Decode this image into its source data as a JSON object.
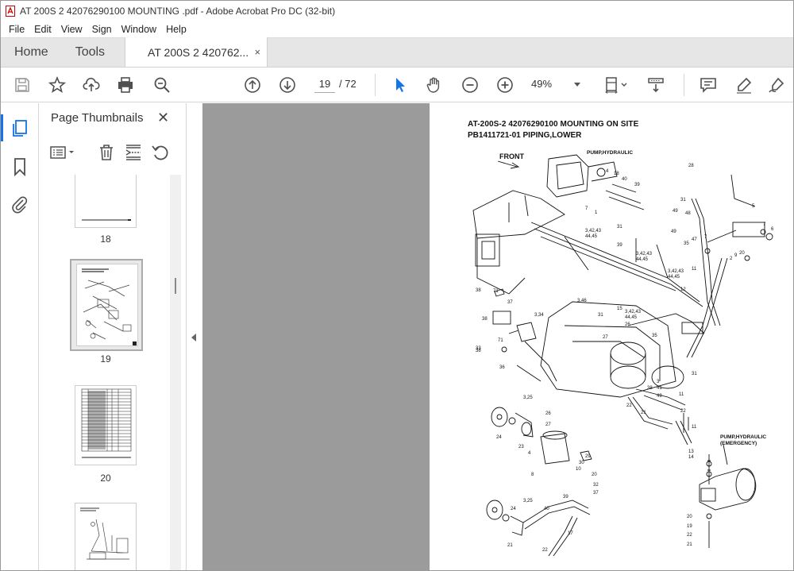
{
  "window": {
    "title": "AT 200S 2 42076290100 MOUNTING .pdf - Adobe Acrobat Pro DC (32-bit)"
  },
  "menu": [
    "File",
    "Edit",
    "View",
    "Sign",
    "Window",
    "Help"
  ],
  "tabs": {
    "home": "Home",
    "tools": "Tools",
    "document": "AT 200S 2 420762...",
    "close": "×"
  },
  "toolbar": {
    "current_page": "19",
    "page_total": "/ 72",
    "zoom": "49%"
  },
  "icons": [
    "save-icon",
    "star-icon",
    "upload-icon",
    "print-icon",
    "zoom-search-icon",
    "page-up-icon",
    "page-down-icon",
    "select-cursor-icon",
    "hand-icon",
    "zoom-out-icon",
    "zoom-in-icon",
    "fit-page-icon",
    "scroll-mode-icon",
    "comment-icon",
    "highlight-pen-icon",
    "sign-pen-icon"
  ],
  "panel": {
    "title": "Page Thumbnails",
    "close": "✕",
    "thumbnails": [
      {
        "label": "18"
      },
      {
        "label": "19",
        "selected": true
      },
      {
        "label": "20"
      },
      {
        "label": ""
      }
    ]
  },
  "document": {
    "heading1": "AT-200S-2 42076290100 MOUNTING ON SITE",
    "heading2": "PB1411721-01 PIPING,LOWER",
    "labels": {
      "front": "FRONT",
      "pump_hydraulic": "PUMP,HYDRAULIC",
      "pump_emergency_1": "PUMP,HYDRAULIC",
      "pump_emergency_2": "(EMERGENCY)"
    },
    "callouts": [
      "4",
      "18",
      "40",
      "39",
      "7",
      "1",
      "31",
      "3,42,43",
      "44,45",
      "39",
      "3,42,43",
      "44,45",
      "3,42,43",
      "44,45",
      "12",
      "28",
      "31",
      "48",
      "49",
      "49",
      "5",
      "7",
      "6",
      "47",
      "35",
      "7",
      "2",
      "20",
      "9",
      "11",
      "37",
      "71",
      "38",
      "38",
      "33",
      "3,34",
      "71",
      "38",
      "36",
      "3,46",
      "15",
      "31",
      "3,42,43",
      "44,45",
      "26",
      "27",
      "35",
      "11",
      "31",
      "3",
      "41",
      "38",
      "49",
      "22",
      "21",
      "22",
      "3,25",
      "26",
      "27",
      "24",
      "23",
      "4",
      "8",
      "30",
      "29",
      "10",
      "20",
      "32",
      "37",
      "11",
      "13",
      "14",
      "3,25",
      "24",
      "40",
      "39",
      "17",
      "21",
      "22",
      "20",
      "19",
      "22",
      "21"
    ]
  }
}
